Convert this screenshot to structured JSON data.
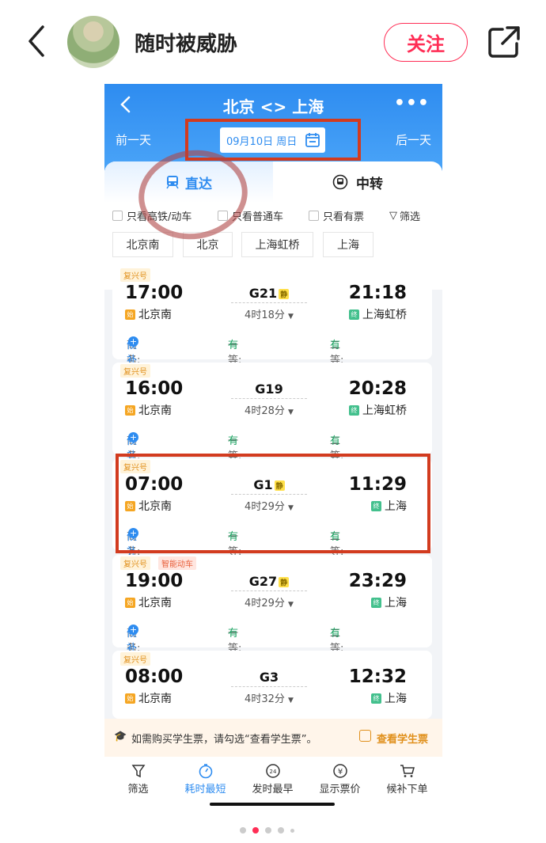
{
  "profile": {
    "username": "随时被威胁",
    "follow_label": "关注"
  },
  "app": {
    "route": "北京 <> 上海",
    "more": "•••",
    "prev_day": "前一天",
    "next_day": "后一天",
    "date": "09月10日 周日"
  },
  "tabs": {
    "direct": "直达",
    "transfer": "中转"
  },
  "filters": {
    "high_speed": "只看高铁/动车",
    "normal": "只看普通车",
    "available": "只看有票",
    "filter": "筛选"
  },
  "stations": [
    "北京南",
    "北京",
    "上海虹桥",
    "上海"
  ],
  "trains": [
    {
      "badge": "复兴号",
      "badge2": "",
      "dep_time": "17:00",
      "dep_station": "北京南",
      "train_no": "G21",
      "quiet": "静",
      "duration": "4时18分",
      "arr_time": "21:18",
      "arr_station": "上海虹桥",
      "business_label": "商务:",
      "business_value": "候补",
      "first_label": "一等:",
      "first_value": "有",
      "second_label": "二等:",
      "second_value": "有"
    },
    {
      "badge": "复兴号",
      "badge2": "",
      "dep_time": "16:00",
      "dep_station": "北京南",
      "train_no": "G19",
      "quiet": "",
      "duration": "4时28分",
      "arr_time": "20:28",
      "arr_station": "上海虹桥",
      "business_label": "商务:",
      "business_value": "候补",
      "first_label": "一等:",
      "first_value": "有",
      "second_label": "二等:",
      "second_value": "有"
    },
    {
      "badge": "复兴号",
      "badge2": "",
      "dep_time": "07:00",
      "dep_station": "北京南",
      "train_no": "G1",
      "quiet": "静",
      "duration": "4时29分",
      "arr_time": "11:29",
      "arr_station": "上海",
      "business_label": "商务:",
      "business_value": "候补",
      "first_label": "一等:",
      "first_value": "有",
      "second_label": "二等:",
      "second_value": "有"
    },
    {
      "badge": "复兴号",
      "badge2": "智能动车",
      "dep_time": "19:00",
      "dep_station": "北京南",
      "train_no": "G27",
      "quiet": "静",
      "duration": "4时29分",
      "arr_time": "23:29",
      "arr_station": "上海",
      "business_label": "商务:",
      "business_value": "候补",
      "first_label": "一等:",
      "first_value": "有",
      "second_label": "二等:",
      "second_value": "有"
    },
    {
      "badge": "复兴号",
      "badge2": "",
      "dep_time": "08:00",
      "dep_station": "北京南",
      "train_no": "G3",
      "quiet": "",
      "duration": "4时32分",
      "arr_time": "12:32",
      "arr_station": "上海",
      "business_label": "",
      "business_value": "",
      "first_label": "",
      "first_value": "",
      "second_label": "",
      "second_value": ""
    }
  ],
  "student": {
    "notice": "如需购买学生票，请勾选“查看学生票”。",
    "toggle": "查看学生票"
  },
  "bottom_nav": [
    {
      "label": "筛选"
    },
    {
      "label": "耗时最短"
    },
    {
      "label": "发时最早"
    },
    {
      "label": "显示票价"
    },
    {
      "label": "候补下单"
    }
  ],
  "tag_start": "始",
  "tag_end": "终",
  "accent": "#2e8cf0"
}
